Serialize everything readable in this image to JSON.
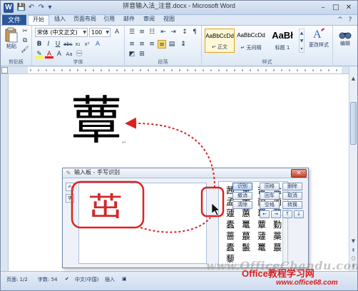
{
  "window": {
    "title": "拼音输入法_注音.docx - Microsoft Word",
    "app_icon": "W",
    "qat": {
      "save": "💾",
      "undo": "↶",
      "redo": "↷",
      "more": "▾"
    },
    "controls": {
      "minimize": "–",
      "maximize": "□",
      "close": "✕"
    }
  },
  "tabs": {
    "file": "文件",
    "items": [
      {
        "label": "开始",
        "active": true
      },
      {
        "label": "插入"
      },
      {
        "label": "页面布局"
      },
      {
        "label": "引用"
      },
      {
        "label": "邮件"
      },
      {
        "label": "审阅"
      },
      {
        "label": "视图"
      }
    ],
    "right_icons": {
      "minimize_ribbon": "^",
      "help": "?"
    }
  },
  "ribbon": {
    "clipboard": {
      "paste_label": "粘贴",
      "group_label": "剪贴板"
    },
    "font": {
      "group_label": "字体",
      "font_name": "宋体 (中文正文)",
      "font_size": "100",
      "buttons": [
        "B",
        "I",
        "U",
        "abc",
        "x₂",
        "x²",
        "A",
        "A",
        "A",
        "Aa",
        "A",
        "A"
      ]
    },
    "paragraph": {
      "group_label": "段落"
    },
    "styles": {
      "group_label": "样式",
      "items": [
        {
          "sample": "AaBbCcDd",
          "name": "↵ 正文",
          "selected": true
        },
        {
          "sample": "AaBbCcDd",
          "name": "↵ 无间隔",
          "selected": false
        },
        {
          "sample": "AaBł",
          "name": "标题 1",
          "selected": false
        }
      ],
      "change_styles": "更改样式"
    },
    "editing": {
      "label": "编辑"
    }
  },
  "document": {
    "big_char": "蕈",
    "paragraph_mark": "↵"
  },
  "status": {
    "page": "页面: 1/2",
    "words": "字数: 54",
    "language": "中文(中国)",
    "insert_mode": "插入"
  },
  "handwriting_panel": {
    "title": "输入板 - 手写识别",
    "close": "✕",
    "side_icons": {
      "hand": "✍",
      "dict": "字"
    },
    "strokes_char": "茁",
    "candidates": [
      "茜",
      "革",
      "苦",
      "盐",
      "孟",
      "黄",
      "茵",
      "蔺",
      "蘧",
      "蕙",
      "鼍",
      "蕈",
      "蠹",
      "鼍",
      "蕈",
      "勤",
      "蔷",
      "蕞",
      "蘧",
      "藁",
      "蠹",
      "鬣",
      "鼍",
      "蕞",
      "藜",
      "",
      "",
      ""
    ],
    "buttons": {
      "recognize": "识别",
      "undo": "撤消",
      "clear": "清除",
      "backspace": "回格",
      "delete": "删除",
      "enter": "回车",
      "cancel": "取消",
      "space": "空格",
      "ime": "转换"
    },
    "arrows": [
      "←",
      "→",
      "↑",
      "↓"
    ]
  },
  "watermark": {
    "main": "www.OfficeChandu.com",
    "brand": "Office教程学习网",
    "url": "www.office68.com"
  },
  "colors": {
    "file_tab": "#2b579a",
    "annotation": "#e02020"
  }
}
